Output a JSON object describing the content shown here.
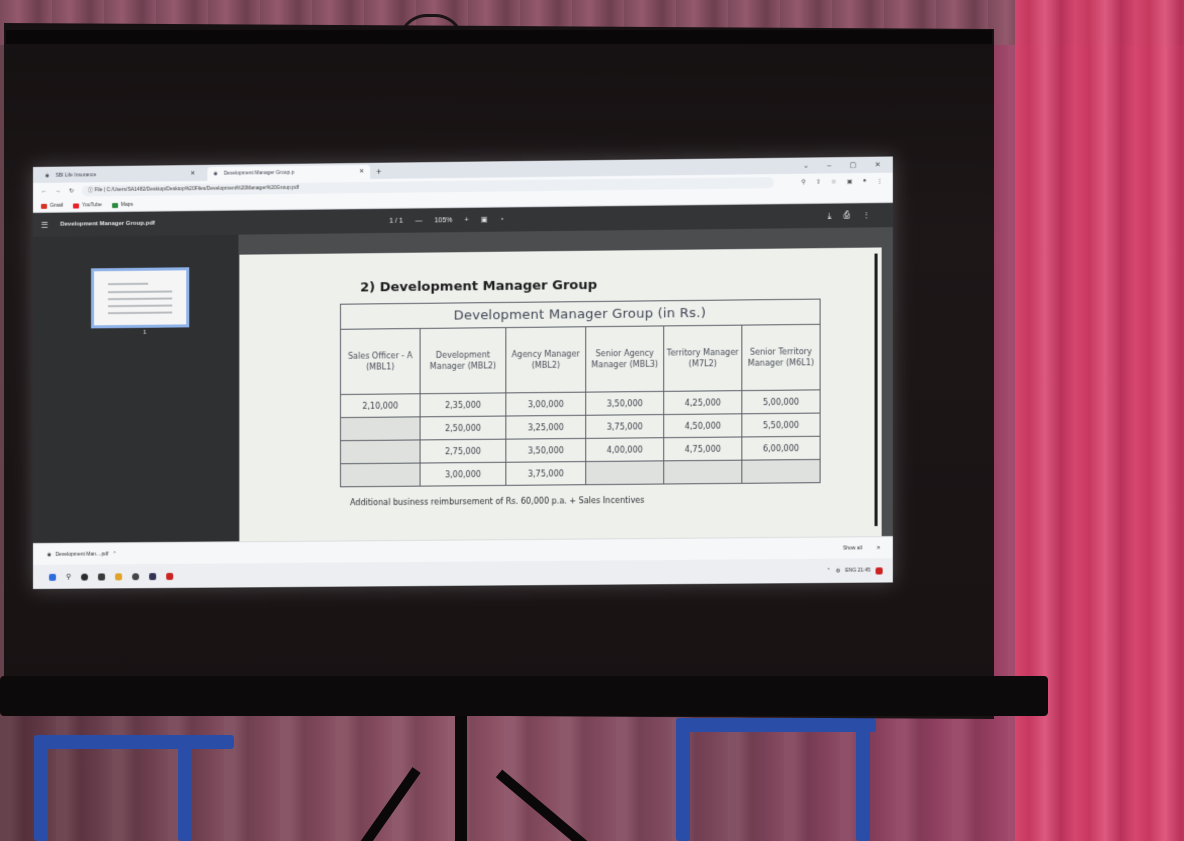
{
  "browser": {
    "tabs": [
      {
        "label": "SBI Life Insurance",
        "active": false
      },
      {
        "label": "Development Manager Group.p",
        "active": true
      }
    ],
    "new_tab": "+",
    "window_controls": [
      "⌄",
      "–",
      "▢",
      "✕"
    ],
    "address": "C:/Users/SA1482/Desktop/Desktop%20Files/Development%20Manager%20Group.pdf",
    "address_prefix": "File",
    "bookmarks": [
      {
        "label": "Gmail",
        "color": "#d93025"
      },
      {
        "label": "YouTube",
        "color": "#e8202a"
      },
      {
        "label": "Maps",
        "color": "#2a8a3e"
      }
    ]
  },
  "pdf_viewer": {
    "title": "Development Manager Group.pdf",
    "page_indicator": "1 / 1",
    "zoom": "105%",
    "thumbnail_page": "1"
  },
  "document": {
    "heading": "2) Development Manager Group",
    "table_caption": "Development Manager Group (in Rs.)",
    "columns": [
      "Sales Officer - A (MBL1)",
      "Development Manager (MBL2)",
      "Agency Manager (MBL2)",
      "Senior Agency Manager (MBL3)",
      "Territory Manager (M7L2)",
      "Senior Territory Manager (M6L1)"
    ],
    "rows": [
      [
        "2,10,000",
        "2,35,000",
        "3,00,000",
        "3,50,000",
        "4,25,000",
        "5,00,000"
      ],
      [
        "",
        "2,50,000",
        "3,25,000",
        "3,75,000",
        "4,50,000",
        "5,50,000"
      ],
      [
        "",
        "2,75,000",
        "3,50,000",
        "4,00,000",
        "4,75,000",
        "6,00,000"
      ],
      [
        "",
        "3,00,000",
        "3,75,000",
        "",
        "",
        ""
      ]
    ],
    "note": "Additional business reimbursement of Rs. 60,000 p.a. + Sales Incentives"
  },
  "download_bar": {
    "file": "Development Man....pdf",
    "show_all": "Show all"
  },
  "taskbar": {
    "tray_text": "ENG 21:45"
  },
  "colors": {
    "curtain": "#8d5064",
    "curtain_bright": "#d8466f",
    "screen_case": "#151011",
    "stand_frame": "#2a4da8",
    "pdf_toolbar": "#333537",
    "thumbnail_border": "#8fb2e8"
  }
}
